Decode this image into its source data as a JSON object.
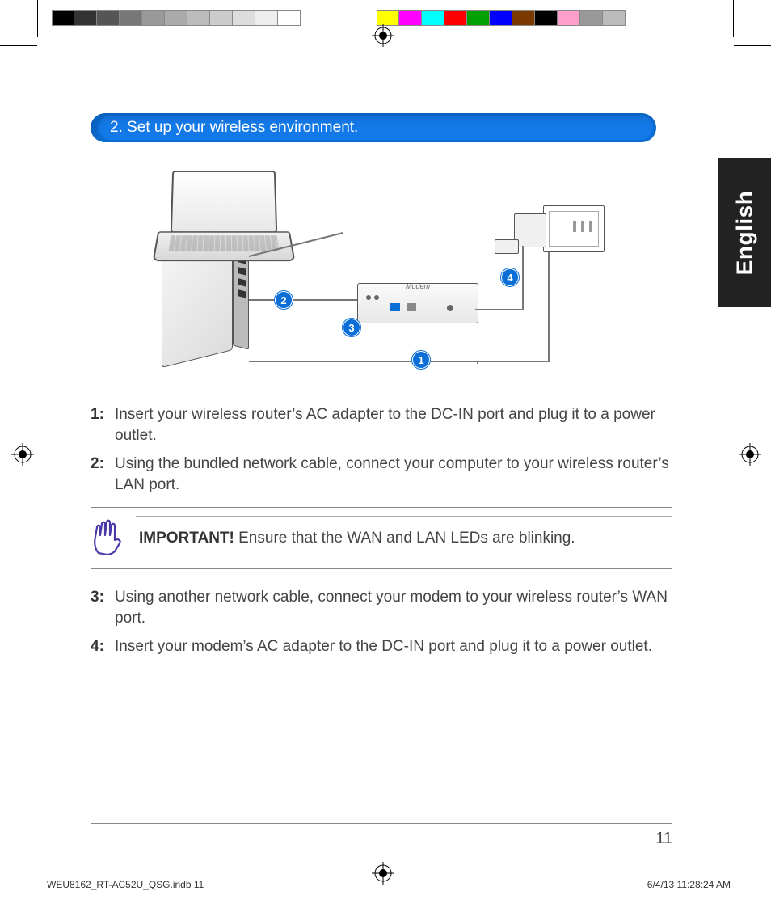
{
  "colorbar_left": [
    "#000000",
    "#333333",
    "#555555",
    "#777777",
    "#999999",
    "#aaaaaa",
    "#bbbbbb",
    "#cccccc",
    "#dddddd",
    "#eeeeee",
    "#ffffff"
  ],
  "colorbar_right": [
    "#ffff00",
    "#ff00ff",
    "#00ffff",
    "#ff0000",
    "#00a000",
    "#0000ff",
    "#7a3a00",
    "#000000",
    "#ff9ecb",
    "#999999",
    "#bbbbbb"
  ],
  "language_tab": "English",
  "header": {
    "title": "2.  Set up your wireless environment."
  },
  "diagram": {
    "modem_label": "Modem",
    "callouts": {
      "c1": "1",
      "c2": "2",
      "c3": "3",
      "c4": "4"
    }
  },
  "steps": {
    "s1": {
      "num": "1:",
      "text": "Insert your wireless router’s AC adapter to the DC-IN port and plug it to a power outlet."
    },
    "s2": {
      "num": "2:",
      "text": "Using the bundled network cable, connect your computer to your wireless router’s LAN port."
    },
    "s3": {
      "num": "3:",
      "text": "Using another network cable, connect your modem to your wireless router’s WAN port."
    },
    "s4": {
      "num": "4:",
      "text": "Insert your modem’s AC adapter to the DC-IN port and plug it to a power outlet."
    }
  },
  "important": {
    "label": "IMPORTANT!",
    "text": "  Ensure that the WAN and LAN LEDs are blinking."
  },
  "page_number": "11",
  "footer": {
    "file": "WEU8162_RT-AC52U_QSG.indb   11",
    "date": "6/4/13   11:28:24 AM"
  }
}
